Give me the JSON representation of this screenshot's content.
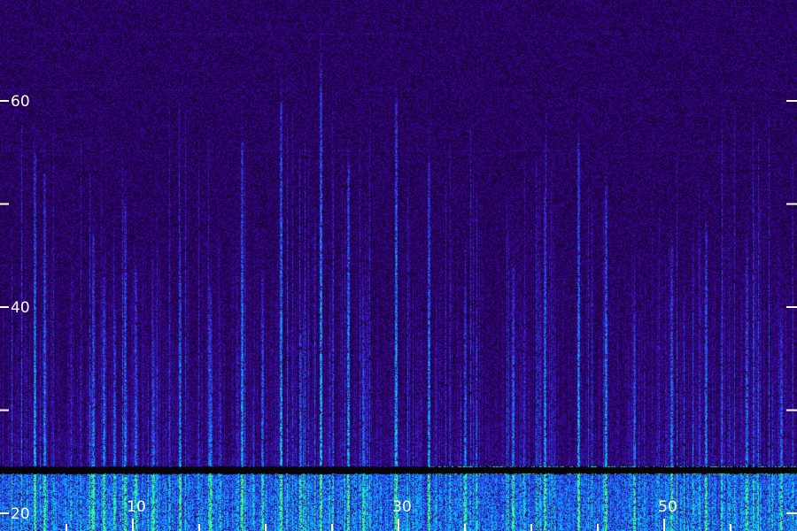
{
  "chart_data": {
    "type": "heatmap",
    "title": "",
    "xlabel": "",
    "ylabel": "",
    "xlim": [
      0,
      60
    ],
    "ylim": [
      20,
      65
    ],
    "x_ticks_major": [
      {
        "value": 10,
        "label": "10"
      },
      {
        "value": 30,
        "label": "30"
      },
      {
        "value": 50,
        "label": "50"
      }
    ],
    "x_ticks_minor": [
      5,
      15,
      20,
      25,
      35,
      40,
      45,
      55
    ],
    "y_ticks_major": [
      {
        "value": 20,
        "label": "20"
      },
      {
        "value": 40,
        "label": "40"
      },
      {
        "value": 60,
        "label": "60"
      }
    ],
    "y_ticks_minor": [
      30,
      50
    ],
    "colormap": [
      "#000000",
      "#2a0060",
      "#3a10b0",
      "#2060ff",
      "#00c8ff",
      "#40ff80"
    ],
    "tone_level": 24.2,
    "events": [
      {
        "x": 2.6,
        "top": 55,
        "strength": 0.8
      },
      {
        "x": 3.3,
        "top": 53,
        "strength": 0.6
      },
      {
        "x": 7.0,
        "top": 47,
        "strength": 0.6
      },
      {
        "x": 7.8,
        "top": 43,
        "strength": 0.7
      },
      {
        "x": 8.6,
        "top": 40,
        "strength": 0.5
      },
      {
        "x": 9.4,
        "top": 50,
        "strength": 0.6
      },
      {
        "x": 10.2,
        "top": 44,
        "strength": 0.5
      },
      {
        "x": 11.5,
        "top": 37,
        "strength": 0.5
      },
      {
        "x": 13.5,
        "top": 39,
        "strength": 0.7
      },
      {
        "x": 15.8,
        "top": 42,
        "strength": 0.6
      },
      {
        "x": 18.2,
        "top": 56,
        "strength": 0.8
      },
      {
        "x": 19.7,
        "top": 43,
        "strength": 0.5
      },
      {
        "x": 21.1,
        "top": 60,
        "strength": 0.9
      },
      {
        "x": 22.6,
        "top": 38,
        "strength": 0.5
      },
      {
        "x": 24.1,
        "top": 63,
        "strength": 1.0
      },
      {
        "x": 26.2,
        "top": 54,
        "strength": 0.9
      },
      {
        "x": 27.3,
        "top": 36,
        "strength": 0.5
      },
      {
        "x": 29.8,
        "top": 60,
        "strength": 0.9
      },
      {
        "x": 32.3,
        "top": 54,
        "strength": 0.8
      },
      {
        "x": 35.0,
        "top": 41,
        "strength": 0.5
      },
      {
        "x": 38.6,
        "top": 44,
        "strength": 0.6
      },
      {
        "x": 41.0,
        "top": 51,
        "strength": 0.7
      },
      {
        "x": 43.5,
        "top": 56,
        "strength": 0.8
      },
      {
        "x": 45.6,
        "top": 52,
        "strength": 0.8
      },
      {
        "x": 47.7,
        "top": 40,
        "strength": 0.5
      },
      {
        "x": 50.5,
        "top": 46,
        "strength": 0.6
      },
      {
        "x": 53.1,
        "top": 48,
        "strength": 0.7
      },
      {
        "x": 56.2,
        "top": 45,
        "strength": 0.6
      },
      {
        "x": 58.8,
        "top": 38,
        "strength": 0.5
      }
    ]
  }
}
